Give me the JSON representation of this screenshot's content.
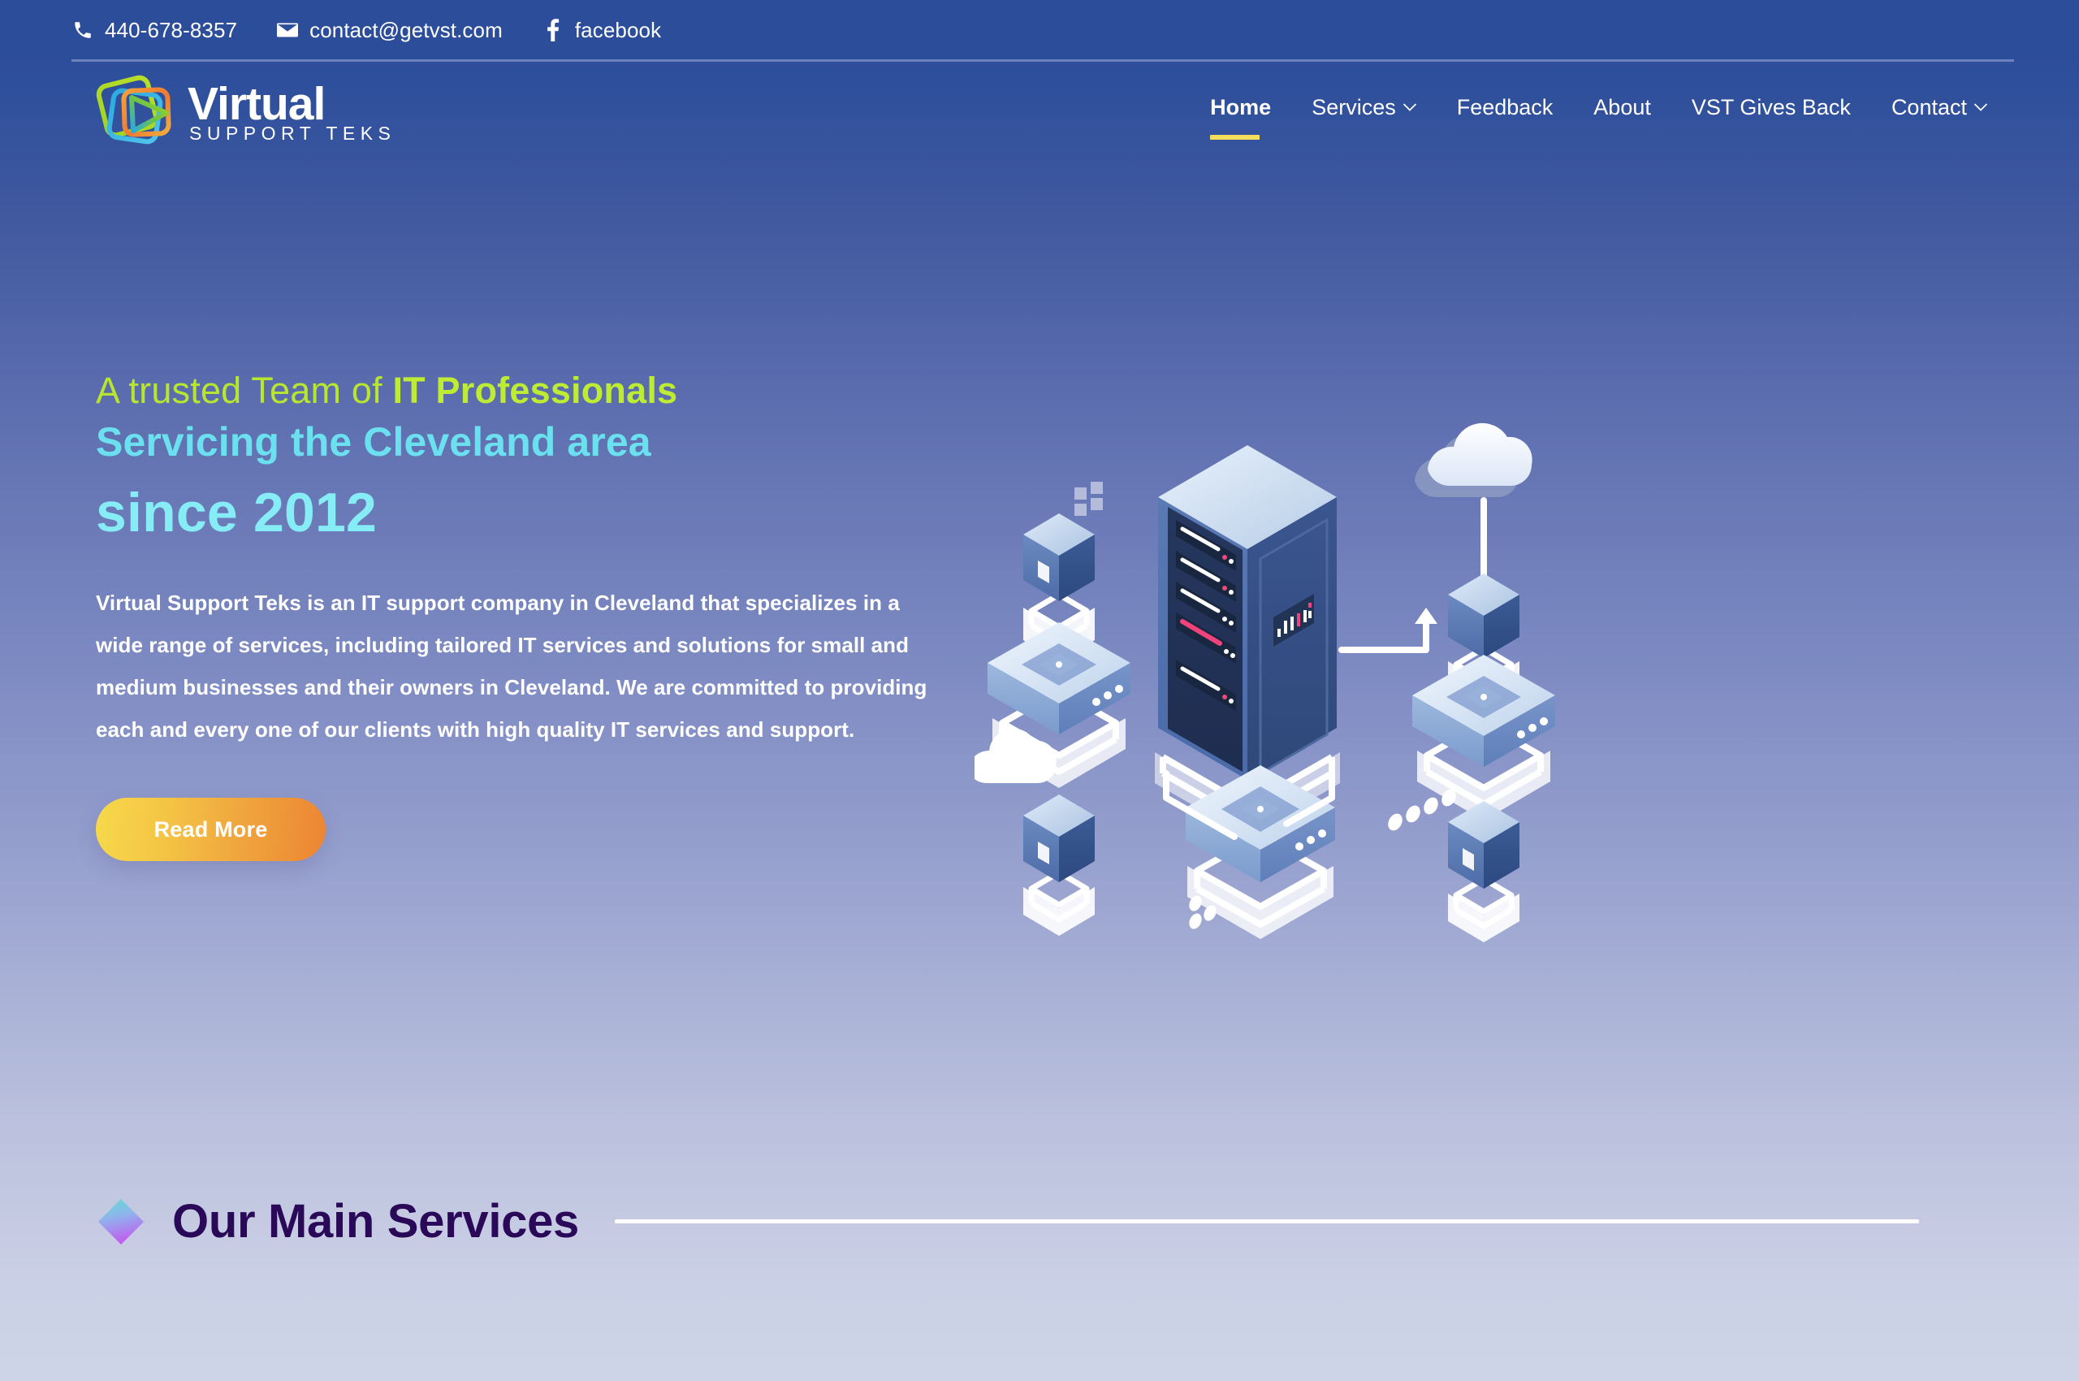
{
  "topbar": {
    "phone": {
      "label": "440-678-8357",
      "icon": "phone-icon"
    },
    "email": {
      "label": "contact@getvst.com",
      "icon": "envelope-icon"
    },
    "facebook": {
      "label": "facebook",
      "icon": "facebook-icon"
    }
  },
  "logo": {
    "name": "Virtual",
    "tagline": "SUPPORT TEKS",
    "colors": {
      "square_green": "#9fd51f",
      "square_orange": "#f07d30",
      "square_blue": "#29aae1",
      "play_gradient_from": "#29aae1",
      "play_gradient_to": "#9fd51f"
    }
  },
  "nav": {
    "items": [
      {
        "label": "Home",
        "active": true,
        "caret": false
      },
      {
        "label": "Services",
        "active": false,
        "caret": true
      },
      {
        "label": "Feedback",
        "active": false,
        "caret": false
      },
      {
        "label": "About",
        "active": false,
        "caret": false
      },
      {
        "label": "VST Gives Back",
        "active": false,
        "caret": false
      },
      {
        "label": "Contact",
        "active": false,
        "caret": true
      }
    ],
    "active_underline_color": "#f5dd5c"
  },
  "hero": {
    "eyebrow_plain": "A trusted Team of ",
    "eyebrow_bold": "IT Professionals",
    "headline_line2": "Servicing the Cleveland area",
    "headline_line3": "since 2012",
    "paragraph": "Virtual Support Teks is an IT support company in Cleveland that specializes in a wide range of services, including tailored IT services and solutions for small and medium businesses and their owners in Cleveland. We are committed to providing each and every one of our clients with high quality IT services and support.",
    "cta_label": "Read More",
    "colors": {
      "eyebrow": "#b8e62e",
      "headline_line2": "#6be0ef",
      "headline_line3": "#86ecf6",
      "paragraph": "#ffffff",
      "cta_gradient_from": "#f7d94a",
      "cta_gradient_to": "#ec8533"
    },
    "illustration": {
      "name": "isometric-server-network-illustration",
      "elements": [
        "server-rack",
        "data-cubes",
        "network-switches",
        "clouds",
        "connection-lines",
        "pixel-dots"
      ]
    }
  },
  "services_section": {
    "title": "Our Main Services",
    "diamond_icon": "diamond-icon",
    "title_color": "#2a0a58",
    "diamond_gradient_from": "#5ee0d0",
    "diamond_gradient_to": "#c060f0",
    "rule_color": "#ffffff"
  },
  "page": {
    "background_top": "#2c4d9a",
    "background_bottom": "#ced4e7",
    "topbar_color": "#2c4d9a"
  }
}
